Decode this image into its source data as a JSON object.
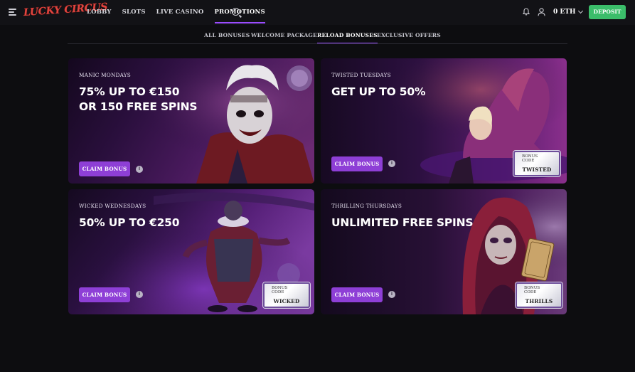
{
  "brand": {
    "logo_text": "LUCKY CIRCUS"
  },
  "nav": {
    "items": [
      "LOBBY",
      "SLOTS",
      "LIVE CASINO",
      "PROMOTIONS"
    ]
  },
  "header": {
    "balance": "0 ETH",
    "deposit_label": "DEPOSIT"
  },
  "tabs": [
    "ALL BONUSES",
    "WELCOME PACKAGE",
    "RELOAD BONUSES",
    "EXCLUSIVE OFFERS"
  ],
  "cards": [
    {
      "subtitle": "MANIC MONDAYS",
      "headline_1": "75% UP TO €150",
      "headline_2": "OR 150 FREE SPINS",
      "cta": "CLAIM BONUS"
    },
    {
      "subtitle": "TWISTED TUESDAYS",
      "headline_1": "GET UP TO 50%",
      "cta": "CLAIM BONUS",
      "code_label_1": "BONUS",
      "code_label_2": "CODE",
      "code": "TWISTED"
    },
    {
      "subtitle": "WICKED WEDNESDAYS",
      "headline_1": "50% UP TO €250",
      "cta": "CLAIM BONUS",
      "code_label_1": "BONUS",
      "code_label_2": "CODE",
      "code": "WICKED"
    },
    {
      "subtitle": "THRILLING THURSDAYS",
      "headline_1": "UNLIMITED FREE SPINS",
      "cta": "CLAIM BONUS",
      "code_label_1": "BONUS",
      "code_label_2": "CODE",
      "code": "THRILLS"
    }
  ],
  "colors": {
    "accent": "#9a4cff",
    "cta": "#8e3fd6",
    "deposit": "#3bbd6a",
    "logo": "#e0443e"
  }
}
